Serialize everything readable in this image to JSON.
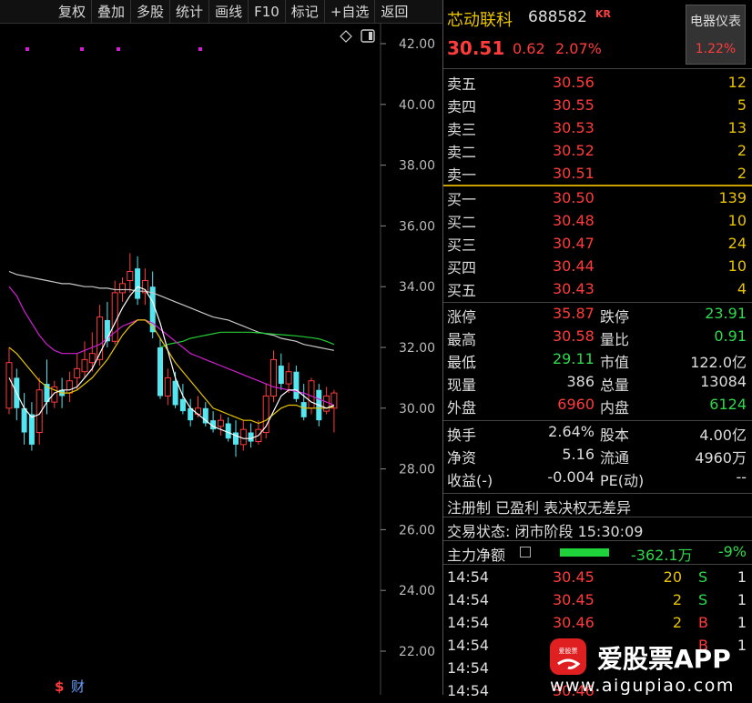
{
  "toolbar": {
    "buttons": [
      "复权",
      "叠加",
      "多股",
      "统计",
      "画线",
      "F10",
      "标记",
      "+自选",
      "返回"
    ]
  },
  "chart": {
    "y_labels": [
      "42.00",
      "40.00",
      "38.00",
      "36.00",
      "34.00",
      "32.00",
      "30.00",
      "28.00",
      "26.00",
      "24.00",
      "22.00"
    ],
    "bottom_marks": [
      "$",
      "财"
    ]
  },
  "chart_data": {
    "type": "candlestick",
    "ylim": [
      21.5,
      42.5
    ],
    "y_ticks": [
      42,
      40,
      38,
      36,
      34,
      32,
      30,
      28,
      26,
      24,
      22
    ],
    "candles": [
      {
        "o": 30.0,
        "c": 31.5,
        "h": 32.0,
        "l": 29.8
      },
      {
        "o": 31.0,
        "c": 30.0,
        "h": 31.3,
        "l": 29.6
      },
      {
        "o": 30.0,
        "c": 29.2,
        "h": 30.5,
        "l": 28.8
      },
      {
        "o": 29.8,
        "c": 28.8,
        "h": 30.2,
        "l": 28.6
      },
      {
        "o": 29.2,
        "c": 30.6,
        "h": 31.0,
        "l": 28.8
      },
      {
        "o": 30.8,
        "c": 30.2,
        "h": 31.6,
        "l": 29.8
      },
      {
        "o": 30.2,
        "c": 30.7,
        "h": 30.9,
        "l": 30.0
      },
      {
        "o": 30.6,
        "c": 30.4,
        "h": 31.0,
        "l": 30.0
      },
      {
        "o": 30.5,
        "c": 30.9,
        "h": 31.2,
        "l": 30.2
      },
      {
        "o": 31.0,
        "c": 31.3,
        "h": 31.8,
        "l": 30.6
      },
      {
        "o": 31.2,
        "c": 31.6,
        "h": 32.2,
        "l": 31.0
      },
      {
        "o": 31.5,
        "c": 31.8,
        "h": 32.5,
        "l": 31.2
      },
      {
        "o": 31.6,
        "c": 33.0,
        "h": 33.4,
        "l": 31.4
      },
      {
        "o": 32.9,
        "c": 32.2,
        "h": 33.5,
        "l": 32.0
      },
      {
        "o": 32.2,
        "c": 33.8,
        "h": 34.2,
        "l": 32.1
      },
      {
        "o": 33.8,
        "c": 34.1,
        "h": 34.3,
        "l": 33.5
      },
      {
        "o": 34.2,
        "c": 34.5,
        "h": 35.1,
        "l": 33.8
      },
      {
        "o": 34.6,
        "c": 33.6,
        "h": 35.0,
        "l": 33.4
      },
      {
        "o": 33.8,
        "c": 34.2,
        "h": 34.6,
        "l": 33.4
      },
      {
        "o": 34.0,
        "c": 32.5,
        "h": 34.5,
        "l": 32.3
      },
      {
        "o": 32.0,
        "c": 30.4,
        "h": 32.3,
        "l": 30.3
      },
      {
        "o": 30.4,
        "c": 31.0,
        "h": 31.3,
        "l": 30.1
      },
      {
        "o": 30.9,
        "c": 30.1,
        "h": 31.2,
        "l": 30.0
      },
      {
        "o": 30.3,
        "c": 29.9,
        "h": 30.8,
        "l": 29.8
      },
      {
        "o": 30.0,
        "c": 29.6,
        "h": 30.3,
        "l": 29.4
      },
      {
        "o": 29.8,
        "c": 30.0,
        "h": 30.4,
        "l": 29.7
      },
      {
        "o": 30.0,
        "c": 29.5,
        "h": 30.2,
        "l": 29.4
      },
      {
        "o": 29.6,
        "c": 29.3,
        "h": 29.9,
        "l": 29.2
      },
      {
        "o": 29.4,
        "c": 29.6,
        "h": 29.8,
        "l": 29.1
      },
      {
        "o": 29.5,
        "c": 29.0,
        "h": 29.7,
        "l": 28.9
      },
      {
        "o": 29.2,
        "c": 28.8,
        "h": 29.6,
        "l": 28.4
      },
      {
        "o": 28.8,
        "c": 29.3,
        "h": 29.6,
        "l": 28.6
      },
      {
        "o": 29.2,
        "c": 28.9,
        "h": 29.5,
        "l": 28.7
      },
      {
        "o": 28.9,
        "c": 29.3,
        "h": 29.6,
        "l": 28.8
      },
      {
        "o": 29.2,
        "c": 30.4,
        "h": 30.8,
        "l": 29.0
      },
      {
        "o": 30.4,
        "c": 31.6,
        "h": 31.9,
        "l": 30.2
      },
      {
        "o": 31.4,
        "c": 30.8,
        "h": 31.8,
        "l": 30.6
      },
      {
        "o": 30.8,
        "c": 31.2,
        "h": 31.5,
        "l": 30.5
      },
      {
        "o": 31.2,
        "c": 30.3,
        "h": 31.4,
        "l": 30.2
      },
      {
        "o": 30.2,
        "c": 29.7,
        "h": 30.8,
        "l": 29.6
      },
      {
        "o": 30.0,
        "c": 30.9,
        "h": 31.0,
        "l": 29.8
      },
      {
        "o": 30.6,
        "c": 29.6,
        "h": 30.8,
        "l": 29.4
      },
      {
        "o": 29.9,
        "c": 30.4,
        "h": 30.7,
        "l": 29.8
      },
      {
        "o": 30.0,
        "c": 30.5,
        "h": 30.6,
        "l": 29.2
      }
    ],
    "ma_white": [
      34.5,
      34.4,
      34.35,
      34.3,
      34.25,
      34.2,
      34.15,
      34.1,
      34.1,
      34.05,
      34.0,
      34.0,
      33.95,
      33.95,
      33.9,
      33.9,
      33.9,
      33.85,
      33.85,
      33.8,
      33.7,
      33.6,
      33.5,
      33.4,
      33.3,
      33.2,
      33.1,
      33.0,
      32.95,
      32.9,
      32.8,
      32.7,
      32.6,
      32.5,
      32.45,
      32.4,
      32.3,
      32.25,
      32.2,
      32.1,
      32.05,
      32.0,
      31.95,
      31.9
    ],
    "ma_green": [
      null,
      null,
      null,
      null,
      null,
      null,
      null,
      null,
      null,
      null,
      null,
      null,
      null,
      null,
      null,
      null,
      null,
      null,
      null,
      null,
      32.0,
      32.1,
      32.15,
      32.2,
      32.3,
      32.35,
      32.4,
      32.45,
      32.5,
      32.5,
      32.5,
      32.5,
      32.5,
      32.48,
      32.46,
      32.44,
      32.42,
      32.4,
      32.38,
      32.35,
      32.32,
      32.28,
      32.2,
      32.1
    ],
    "ma_magenta": [
      34.0,
      33.7,
      33.2,
      32.8,
      32.4,
      32.1,
      31.9,
      31.8,
      31.8,
      31.8,
      31.9,
      32.0,
      32.1,
      32.3,
      32.5,
      32.7,
      32.8,
      32.9,
      32.9,
      32.8,
      32.6,
      32.4,
      32.2,
      32.0,
      31.8,
      31.7,
      31.6,
      31.5,
      31.4,
      31.3,
      31.2,
      31.1,
      31.0,
      30.9,
      30.8,
      30.7,
      30.65,
      30.6,
      30.55,
      30.5,
      30.4,
      30.3,
      30.2,
      30.1
    ],
    "ma_yellow": [
      32.0,
      31.8,
      31.5,
      31.2,
      30.9,
      30.7,
      30.6,
      30.5,
      30.5,
      30.6,
      30.8,
      31.0,
      31.3,
      31.6,
      32.0,
      32.4,
      32.7,
      32.9,
      32.9,
      32.7,
      32.3,
      31.9,
      31.5,
      31.2,
      30.9,
      30.6,
      30.3,
      30.0,
      29.9,
      29.8,
      29.7,
      29.6,
      29.6,
      29.5,
      29.6,
      29.8,
      30.0,
      30.1,
      30.1,
      30.0,
      30.0,
      30.0,
      30.0,
      30.05
    ],
    "ma_white2": [
      31.0,
      30.5,
      30.0,
      29.7,
      29.8,
      30.2,
      30.5,
      30.6,
      30.6,
      30.7,
      31.0,
      31.3,
      31.8,
      32.3,
      32.8,
      33.3,
      33.7,
      34.0,
      33.9,
      33.5,
      32.8,
      31.9,
      31.0,
      30.4,
      30.0,
      29.8,
      29.6,
      29.4,
      29.3,
      29.2,
      29.1,
      29.0,
      29.0,
      29.1,
      29.4,
      29.9,
      30.4,
      30.6,
      30.6,
      30.4,
      30.2,
      30.1,
      30.0,
      30.1
    ]
  },
  "stock": {
    "name": "芯动联科",
    "code": "688582",
    "badge": "KR",
    "price": "30.51",
    "change": "0.62",
    "change_pct": "2.07%",
    "sector_name": "电器仪表",
    "sector_pct": "1.22%"
  },
  "asks": [
    {
      "label": "卖五",
      "price": "30.56",
      "vol": "12"
    },
    {
      "label": "卖四",
      "price": "30.55",
      "vol": "5"
    },
    {
      "label": "卖三",
      "price": "30.53",
      "vol": "13"
    },
    {
      "label": "卖二",
      "price": "30.52",
      "vol": "2"
    },
    {
      "label": "卖一",
      "price": "30.51",
      "vol": "2"
    }
  ],
  "bids": [
    {
      "label": "买一",
      "price": "30.50",
      "vol": "139"
    },
    {
      "label": "买二",
      "price": "30.48",
      "vol": "10"
    },
    {
      "label": "买三",
      "price": "30.47",
      "vol": "24"
    },
    {
      "label": "买四",
      "price": "30.44",
      "vol": "10"
    },
    {
      "label": "买五",
      "price": "30.43",
      "vol": "4"
    }
  ],
  "quote": {
    "zt_l": "涨停",
    "zt_v": "35.87",
    "dt_l": "跌停",
    "dt_v": "23.91",
    "zg_l": "最高",
    "zg_v": "30.58",
    "lb_l": "量比",
    "lb_v": "0.91",
    "zd_l": "最低",
    "zd_v": "29.11",
    "sz_l": "市值",
    "sz_v": "122.0亿",
    "xl_l": "现量",
    "xl_v": "386",
    "zl_l": "总量",
    "zl_v": "13084",
    "wp_l": "外盘",
    "wp_v": "6960",
    "np_l": "内盘",
    "np_v": "6124",
    "hs_l": "换手",
    "hs_v": "2.64%",
    "gb_l": "股本",
    "gb_v": "4.00亿",
    "jz_l": "净资",
    "jz_v": "5.16",
    "lt_l": "流通",
    "lt_v": "4960万",
    "sy_l": "收益(-)",
    "sy_v": "-0.004",
    "pe_l": "PE(动)",
    "pe_v": "--"
  },
  "registration": "注册制 已盈利 表决权无差异",
  "trade_status": "交易状态: 闭市阶段 15:30:09",
  "main_force": {
    "label": "主力净额",
    "value": "-362.1万",
    "pct": "-9%"
  },
  "ticks": [
    {
      "t": "14:54",
      "p": "30.45",
      "v": "20",
      "s": "S",
      "n": "1"
    },
    {
      "t": "14:54",
      "p": "30.45",
      "v": "2",
      "s": "S",
      "n": "1"
    },
    {
      "t": "14:54",
      "p": "30.46",
      "v": "2",
      "s": "B",
      "n": "1"
    },
    {
      "t": "14:54",
      "p": "",
      "v": "",
      "s": "B",
      "n": "1"
    },
    {
      "t": "14:54",
      "p": "",
      "v": "",
      "s": "",
      "n": ""
    },
    {
      "t": "14:54",
      "p": "30.46",
      "v": "",
      "s": "",
      "n": ""
    }
  ],
  "watermark": {
    "brand": "爱股票APP",
    "url": "www.aigupiao.com",
    "icon": "爱股票"
  }
}
